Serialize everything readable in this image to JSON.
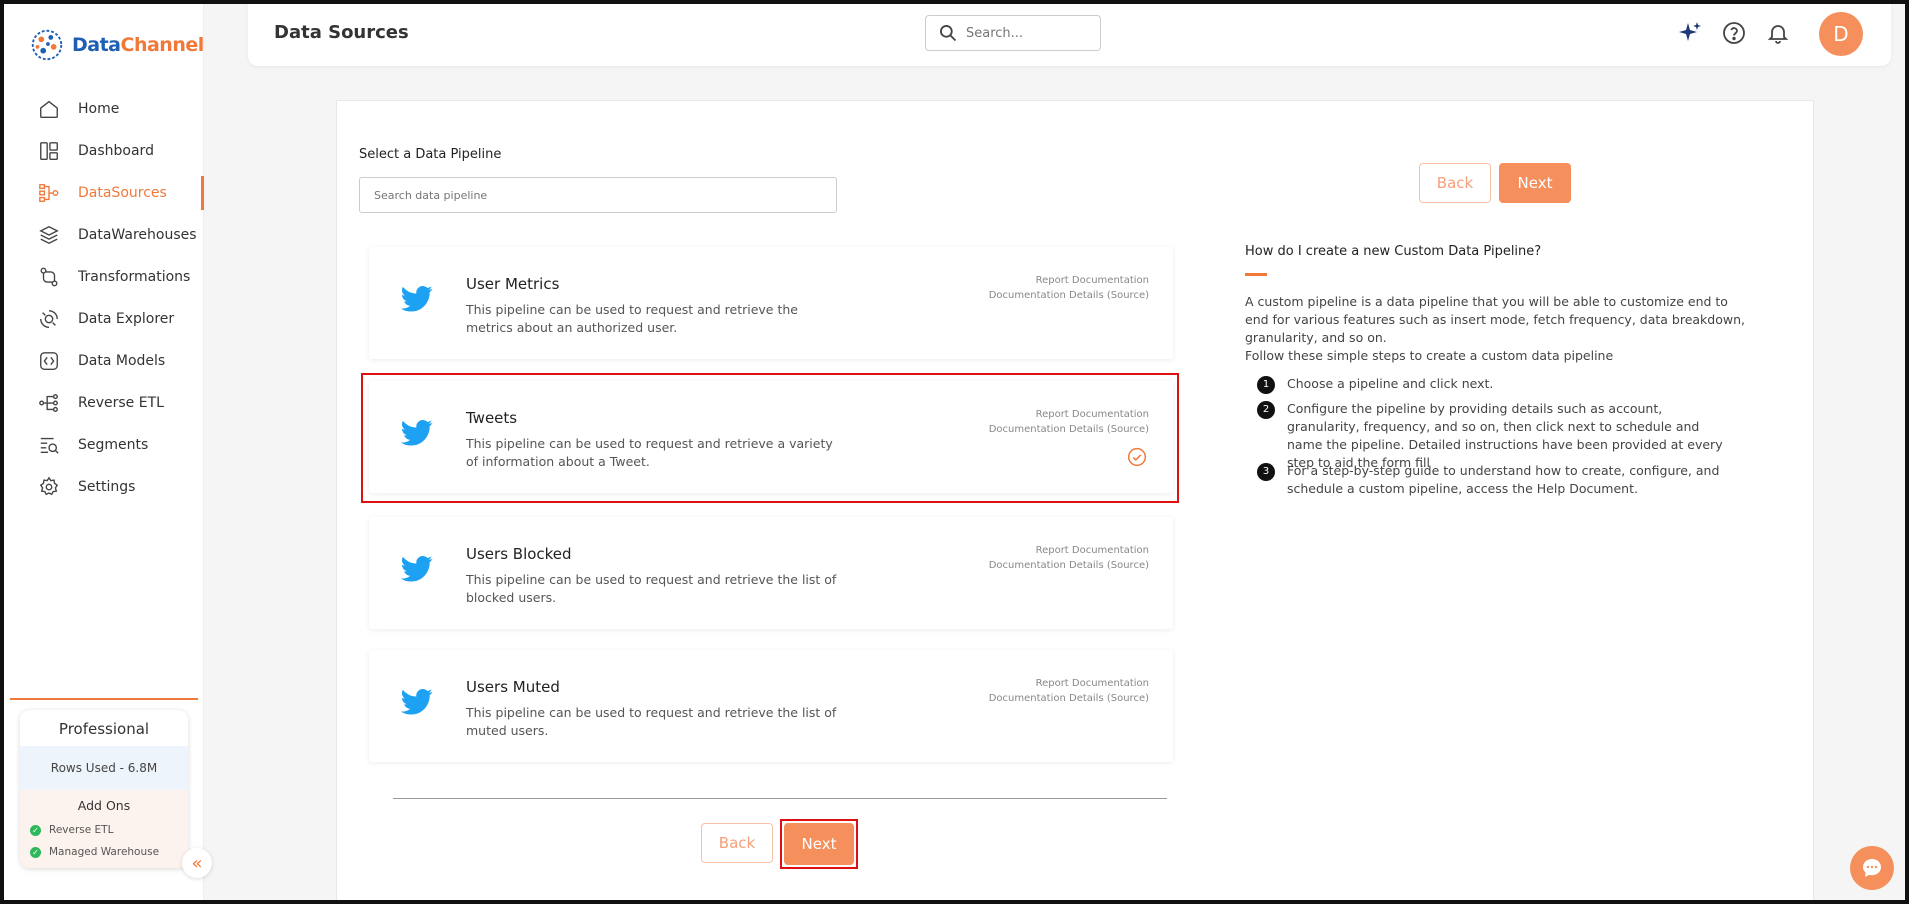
{
  "app": {
    "brand_part1": "Data",
    "brand_part2": "Channel"
  },
  "sidebar": {
    "items": [
      {
        "label": "Home",
        "icon": "home-icon"
      },
      {
        "label": "Dashboard",
        "icon": "dashboard-icon"
      },
      {
        "label": "DataSources",
        "icon": "datasources-icon",
        "active": true
      },
      {
        "label": "DataWarehouses",
        "icon": "datawarehouses-icon"
      },
      {
        "label": "Transformations",
        "icon": "transformations-icon"
      },
      {
        "label": "Data Explorer",
        "icon": "data-explorer-icon"
      },
      {
        "label": "Data Models",
        "icon": "data-models-icon"
      },
      {
        "label": "Reverse ETL",
        "icon": "reverse-etl-icon"
      },
      {
        "label": "Segments",
        "icon": "segments-icon"
      },
      {
        "label": "Settings",
        "icon": "settings-icon"
      }
    ],
    "plan": {
      "title": "Professional",
      "rows_used": "Rows Used - 6.8M",
      "addons_title": "Add Ons",
      "addons": [
        "Reverse ETL",
        "Managed Warehouse"
      ]
    }
  },
  "header": {
    "title": "Data Sources",
    "search_placeholder": "Search...",
    "avatar_initial": "D"
  },
  "main": {
    "select_label": "Select a Data Pipeline",
    "search_placeholder": "Search data pipeline",
    "back_label": "Back",
    "next_label": "Next",
    "pipelines": [
      {
        "name": "User Metrics",
        "desc": "This pipeline can be used to request and retrieve the metrics about an authorized user.",
        "link1": "Report Documentation",
        "link2": "Documentation Details (Source)",
        "selected": false
      },
      {
        "name": "Tweets",
        "desc": "This pipeline can be used to request and retrieve a variety of information about a Tweet.",
        "link1": "Report Documentation",
        "link2": "Documentation Details (Source)",
        "selected": true
      },
      {
        "name": "Users Blocked",
        "desc": "This pipeline can be used to request and retrieve the list of blocked users.",
        "link1": "Report Documentation",
        "link2": "Documentation Details (Source)",
        "selected": false
      },
      {
        "name": "Users Muted",
        "desc": "This pipeline can be used to request and retrieve the list of muted users.",
        "link1": "Report Documentation",
        "link2": "Documentation Details (Source)",
        "selected": false
      }
    ],
    "help": {
      "title": "How do I create a new Custom Data Pipeline?",
      "intro": "A custom pipeline is a data pipeline that you will be able to customize end to end for various features such as insert mode, fetch frequency, data breakdown, granularity, and so on.",
      "intro2": "Follow these simple steps to create a custom data pipeline",
      "steps": [
        {
          "num": "1",
          "text": "Choose a pipeline and click next."
        },
        {
          "num": "2",
          "text": "Configure the pipeline by providing details such as account, granularity, frequency, and so on, then click next to schedule and name the pipeline. Detailed instructions have been provided at every step to aid the form fill"
        },
        {
          "num": "3",
          "text": "For a step-by-step guide to understand how to create, configure, and schedule a custom pipeline, access the Help Document."
        }
      ]
    }
  },
  "colors": {
    "accent": "#f0793a",
    "next_bg": "#f5905d",
    "twitter": "#1da1f2",
    "highlight": "#dd1111"
  }
}
